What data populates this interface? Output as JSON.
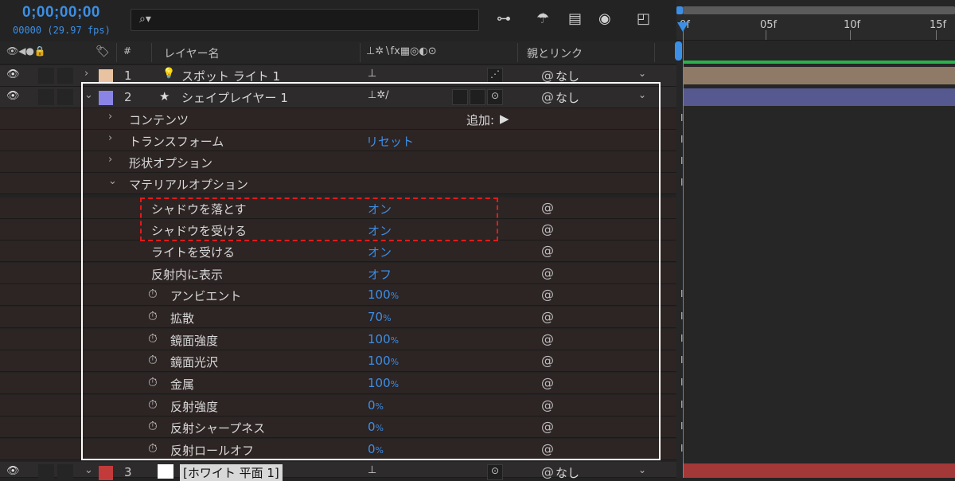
{
  "header": {
    "timecode": "0;00;00;00",
    "frame_info": "00000 (29.97 fps)",
    "search_glyph": "⌕▾",
    "icons": [
      "tree-icon",
      "shy-icon",
      "frame-blend-icon",
      "motion-blur-icon",
      "graph-editor-icon"
    ]
  },
  "columns": {
    "hash": "#",
    "layer_name": "レイヤー名",
    "switches": "⊥✲∖fx▦◎◐⊙",
    "parent": "親とリンク"
  },
  "timeline": {
    "ticks": [
      "0f",
      "05f",
      "10f",
      "15f"
    ]
  },
  "layers": [
    {
      "num": "1",
      "name": "スポット ライト 1",
      "parent": "なし",
      "color": "#e9c3a1"
    },
    {
      "num": "2",
      "name": "シェイプレイヤー 1",
      "parent": "なし",
      "color": "#8a84e6"
    },
    {
      "num": "3",
      "name": "[ホワイト 平面 1]",
      "parent": "なし",
      "color": "#c23a3a"
    }
  ],
  "groups": {
    "contents": "コンテンツ",
    "add_label": "追加:",
    "transform": "トランスフォーム",
    "reset": "リセット",
    "geometry": "形状オプション",
    "material": "マテリアルオプション"
  },
  "material_props": [
    {
      "name": "シャドウを落とす",
      "value": "オン"
    },
    {
      "name": "シャドウを受ける",
      "value": "オン"
    },
    {
      "name": "ライトを受ける",
      "value": "オン"
    },
    {
      "name": "反射内に表示",
      "value": "オフ"
    },
    {
      "name": "アンビエント",
      "value": "100",
      "unit": "%"
    },
    {
      "name": "拡散",
      "value": "70",
      "unit": "%"
    },
    {
      "name": "鏡面強度",
      "value": "100",
      "unit": "%"
    },
    {
      "name": "鏡面光沢",
      "value": "100",
      "unit": "%"
    },
    {
      "name": "金属",
      "value": "100",
      "unit": "%"
    },
    {
      "name": "反射強度",
      "value": "0",
      "unit": "%"
    },
    {
      "name": "反射シャープネス",
      "value": "0",
      "unit": "%"
    },
    {
      "name": "反射ロールオフ",
      "value": "0",
      "unit": "%"
    }
  ],
  "colors": {
    "accent": "#3b8fe6",
    "highlight": "#e11b1b",
    "work_bar": "#2bb24a"
  }
}
